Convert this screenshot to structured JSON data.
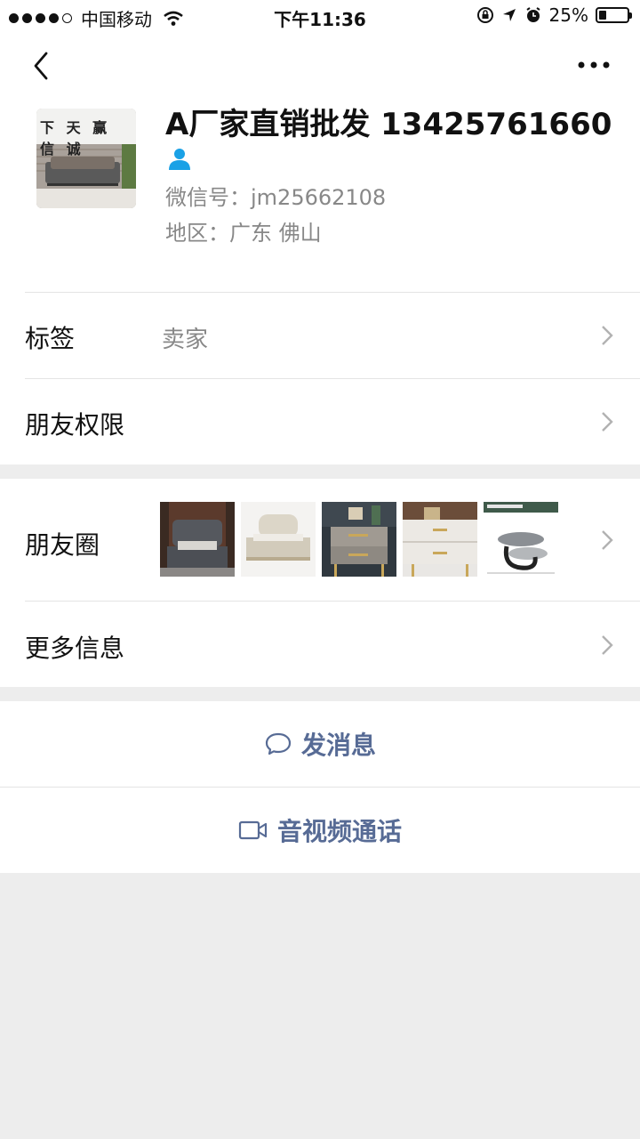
{
  "status_bar": {
    "carrier": "中国移动",
    "time": "下午11:36",
    "battery_text": "25%",
    "battery_level": 0.25
  },
  "profile": {
    "name": "A厂家直销批发 13425761660",
    "wechat_id": "微信号：jm25662108",
    "region": "地区：广东 佛山",
    "avatar_calligraphy": "下 天 赢 信 诚"
  },
  "rows": {
    "tag_label": "标签",
    "tag_value": "卖家",
    "permission_label": "朋友权限",
    "moments_label": "朋友圈",
    "more_info_label": "更多信息"
  },
  "actions": {
    "message_label": "发消息",
    "call_label": "音视频通话"
  },
  "colors": {
    "link": "#576b95",
    "background": "#ededed",
    "person_icon": "#1aa1e6"
  }
}
